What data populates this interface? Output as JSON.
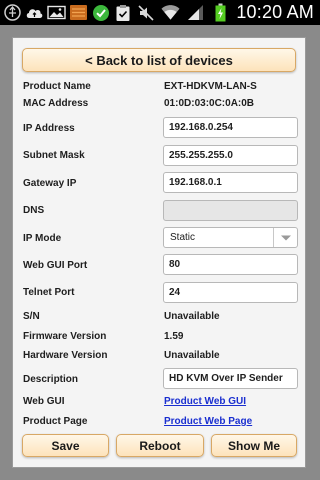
{
  "status_bar": {
    "time": "10:20 AM",
    "icons": [
      "usb-icon",
      "cloud-upload-icon",
      "gallery-icon",
      "storage-icon",
      "check-circle-icon",
      "clipboard-check-icon",
      "mute-icon",
      "wifi-icon",
      "signal-icon",
      "battery-charging-icon"
    ]
  },
  "header": {
    "back_label": "< Back to list of devices"
  },
  "rows": {
    "product_name": {
      "label": "Product Name",
      "value": "EXT-HDKVM-LAN-S"
    },
    "mac_address": {
      "label": "MAC Address",
      "value": "01:0D:03:0C:0A:0B"
    },
    "ip_address": {
      "label": "IP Address",
      "value": "192.168.0.254"
    },
    "subnet_mask": {
      "label": "Subnet Mask",
      "value": "255.255.255.0"
    },
    "gateway_ip": {
      "label": "Gateway IP",
      "value": "192.168.0.1"
    },
    "dns": {
      "label": "DNS",
      "value": ""
    },
    "ip_mode": {
      "label": "IP Mode",
      "value": "Static"
    },
    "web_gui_port": {
      "label": "Web GUI Port",
      "value": "80"
    },
    "telnet_port": {
      "label": "Telnet Port",
      "value": "24"
    },
    "sn": {
      "label": "S/N",
      "value": "Unavailable"
    },
    "firmware_version": {
      "label": "Firmware Version",
      "value": "1.59"
    },
    "hardware_version": {
      "label": "Hardware Version",
      "value": "Unavailable"
    },
    "description": {
      "label": "Description",
      "value": "HD KVM Over IP Sender"
    },
    "web_gui": {
      "label": "Web GUI",
      "value": "Product Web GUI"
    },
    "product_page": {
      "label": "Product Page",
      "value": "Product Web Page"
    }
  },
  "actions": {
    "save": "Save",
    "reboot": "Reboot",
    "show_me": "Show Me"
  },
  "colors": {
    "button_border": "#d8a865",
    "button_fill": "#fde3bb",
    "link": "#1a2fd0",
    "status_bar": "#000000",
    "battery": "#55cc22"
  }
}
